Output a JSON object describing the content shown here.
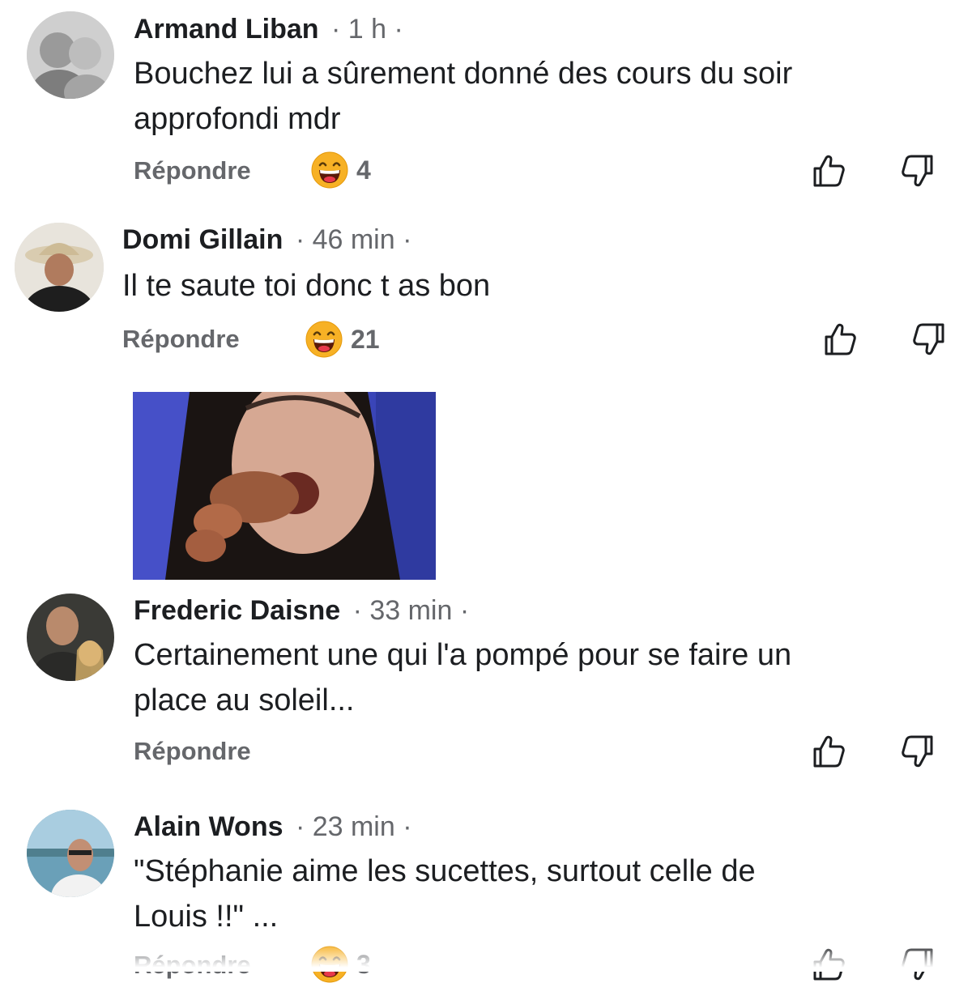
{
  "comments": [
    {
      "author": "Armand Liban",
      "time": "· 1 h ·",
      "text_lines": [
        "Bouchez lui a  sûrement donné des cours du soir",
        "approfondi mdr"
      ],
      "reply_label": "Répondre",
      "reaction": {
        "icon": "laughing-emoji-icon",
        "count": "4"
      }
    },
    {
      "author": "Domi Gillain",
      "time": "· 46 min ·",
      "text_lines": [
        "Il te saute toi donc t as bon"
      ],
      "reply_label": "Répondre",
      "reaction": {
        "icon": "laughing-emoji-icon",
        "count": "21"
      }
    },
    {
      "author": "Frederic Daisne",
      "time": "· 33 min ·",
      "text_lines": [
        "Certainement une qui l'a pompé pour se faire un",
        "place au soleil..."
      ],
      "reply_label": "Répondre"
    },
    {
      "author": "Alain Wons",
      "time": "· 23 min ·",
      "text_lines": [
        "\"Stéphanie aime les sucettes, surtout celle de",
        "Louis !!\" ..."
      ],
      "reply_label": "Répondre",
      "reaction": {
        "icon": "laughing-emoji-icon",
        "count": "3"
      }
    }
  ],
  "icons": {
    "like": "thumbs-up-icon",
    "dislike": "thumbs-down-icon"
  },
  "colors": {
    "text": "#1c1e21",
    "secondary": "#65676b",
    "emoji": "#f7b125"
  }
}
